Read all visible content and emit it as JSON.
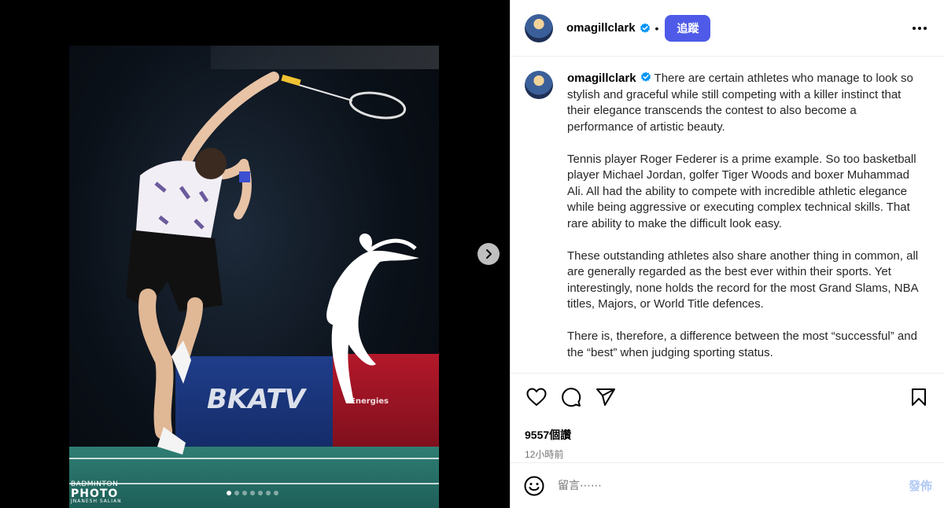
{
  "post": {
    "username": "omagillclark",
    "verified": true,
    "follow_label": "追蹤",
    "separator": "•"
  },
  "media": {
    "watermark": {
      "line1": "BADMINTON",
      "line2": "PHOTO",
      "line3": "JNANESH SALIAN"
    },
    "banner_left": "BKATV",
    "banner_right": "Energies",
    "slide_count": 7,
    "active_slide": 1
  },
  "caption": {
    "username": "omagillclark",
    "paragraphs": [
      "There are certain athletes who manage to look so stylish and graceful while still competing with a killer instinct that their elegance transcends the contest to also become a performance of artistic beauty.",
      "Tennis player Roger Federer is a prime example. So too basketball player Michael Jordan, golfer Tiger Woods and boxer Muhammad Ali. All had the ability to compete with incredible athletic elegance while being aggressive or executing complex technical skills. That rare ability to make the difficult look easy.",
      "These outstanding athletes also share another thing in common, all are generally regarded as the best ever within their sports. Yet interestingly, none holds the record for the most Grand Slams, NBA titles, Majors, or World Title defences.",
      "There is, therefore, a difference between the most “successful” and the “best” when judging sporting status."
    ]
  },
  "stats": {
    "likes": "9557個讚",
    "time": "12小時前"
  },
  "comment": {
    "placeholder": "留言⋯⋯",
    "post_label": "發佈"
  },
  "icons": {
    "like": "heart-icon",
    "comment": "comment-icon",
    "share": "share-icon",
    "save": "bookmark-icon",
    "more": "more-icon",
    "emoji": "emoji-icon",
    "next": "chevron-right-icon",
    "verified": "verified-badge-icon"
  },
  "colors": {
    "follow_button": "#4f5be8",
    "verified": "#0095f6",
    "post_button_disabled": "#b2c9f5"
  }
}
